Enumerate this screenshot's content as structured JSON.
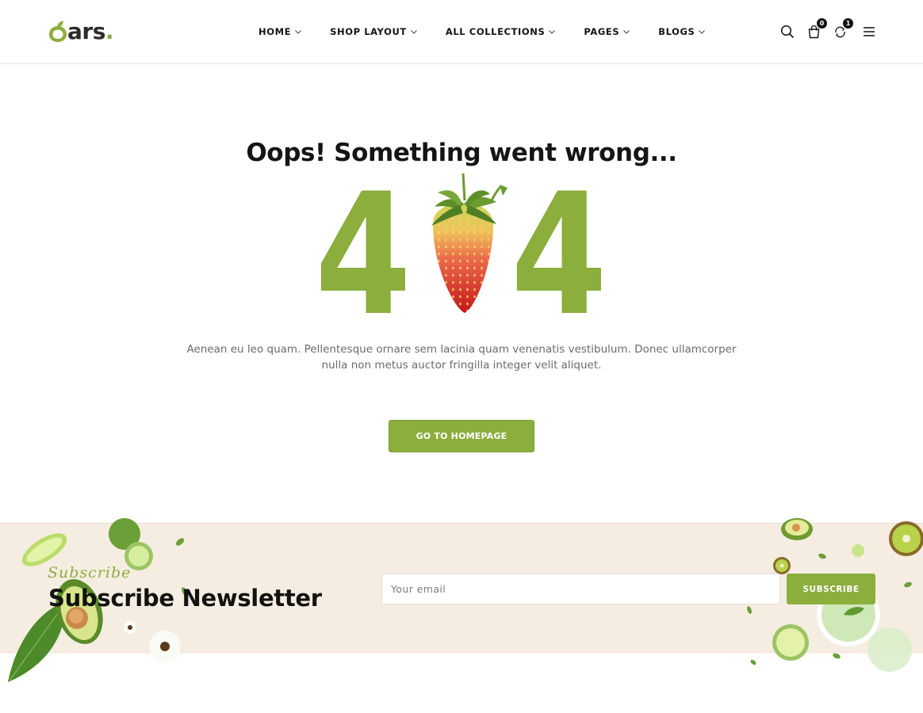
{
  "header": {
    "logo_text": "ars",
    "logo_dot": ".",
    "nav": [
      {
        "label": "HOME"
      },
      {
        "label": "SHOP LAYOUT"
      },
      {
        "label": "ALL COLLECTIONS"
      },
      {
        "label": "PAGES"
      },
      {
        "label": "BLOGS"
      }
    ],
    "cart_count": "0",
    "compare_count": "1",
    "icons": [
      "search-icon",
      "cart-icon",
      "compare-icon",
      "menu-icon"
    ]
  },
  "error": {
    "title": "Oops! Something went wrong...",
    "code_left": "4",
    "code_right": "4",
    "description": "Aenean eu leo quam. Pellentesque ornare sem lacinia quam venenatis vestibulum. Donec ullamcorper nulla non metus auctor fringilla integer velit aliquet.",
    "button_label": "GO TO HOMEPAGE"
  },
  "newsletter": {
    "script_label": "Subscribe",
    "title": "Subscribe Newsletter",
    "email_placeholder": "Your email",
    "button_label": "SUBSCRIBE"
  },
  "colors": {
    "accent": "#8bae3c",
    "newsletter_bg": "#f5ede2",
    "text": "#151515",
    "muted": "#6a6a72"
  }
}
